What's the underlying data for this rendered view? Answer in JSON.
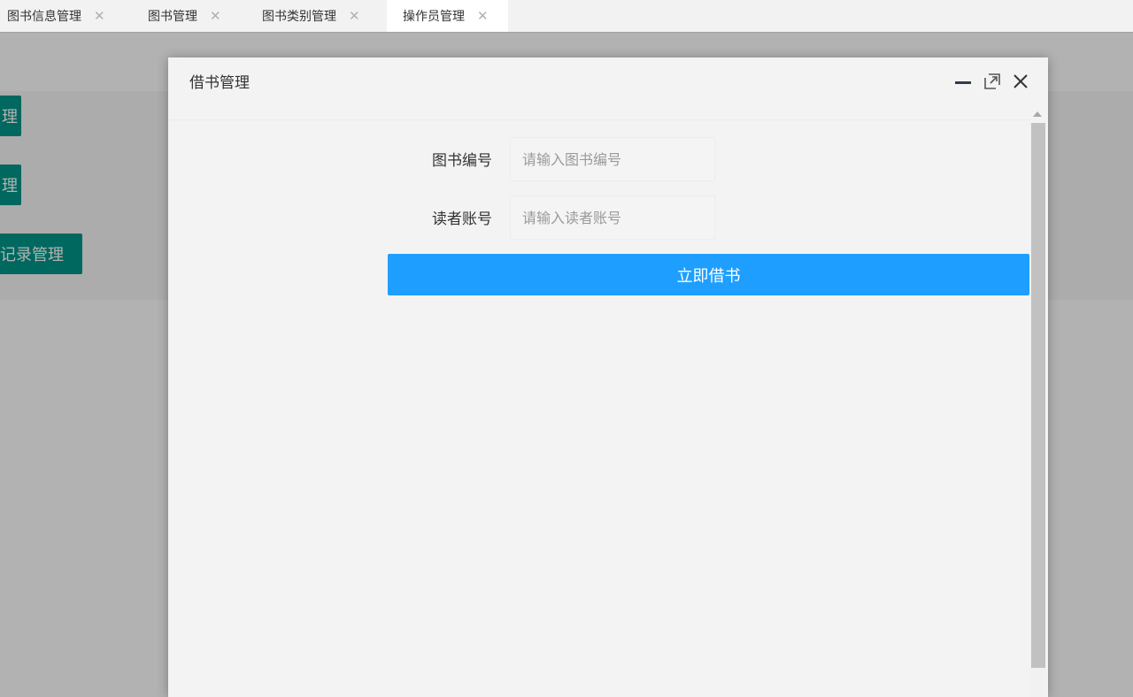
{
  "tabs": [
    {
      "label": "图书信息管理",
      "active": false
    },
    {
      "label": "图书管理",
      "active": false
    },
    {
      "label": "图书类别管理",
      "active": false
    },
    {
      "label": "操作员管理",
      "active": true
    }
  ],
  "background": {
    "buttons": [
      {
        "label": "理"
      },
      {
        "label": "理"
      },
      {
        "label": "记录管理"
      }
    ]
  },
  "dialog": {
    "title": "借书管理",
    "book_id": {
      "label": "图书编号",
      "placeholder": "请输入图书编号",
      "value": ""
    },
    "reader_account": {
      "label": "读者账号",
      "placeholder": "请输入读者账号",
      "value": ""
    },
    "submit_label": "立即借书"
  },
  "colors": {
    "accent": "#1e9fff",
    "page_button": "#009688"
  },
  "icons": {
    "tab_close": "close-icon",
    "minimize": "minimize-icon",
    "maximize": "maximize-icon",
    "close": "close-icon"
  }
}
